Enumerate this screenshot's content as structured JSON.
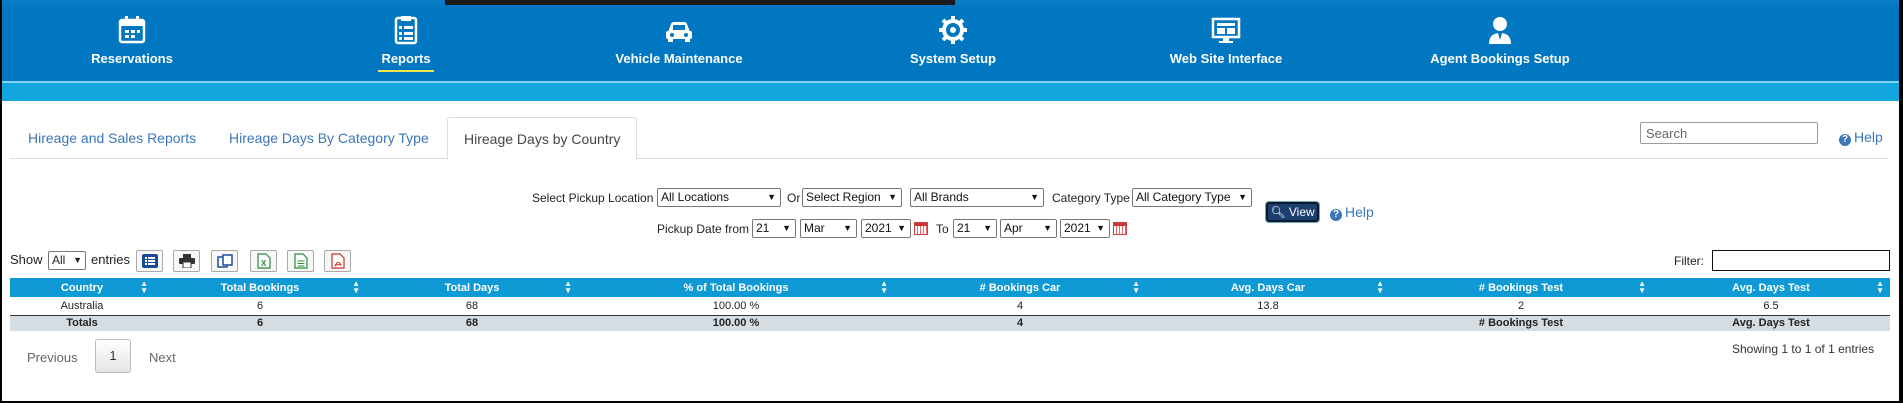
{
  "nav": {
    "items": [
      {
        "label": "Reservations",
        "icon": "calendar-icon"
      },
      {
        "label": "Reports",
        "icon": "clipboard-list-icon",
        "active": true
      },
      {
        "label": "Vehicle Maintenance",
        "icon": "car-icon"
      },
      {
        "label": "System Setup",
        "icon": "gear-icon"
      },
      {
        "label": "Web Site Interface",
        "icon": "monitor-icon"
      },
      {
        "label": "Agent Bookings Setup",
        "icon": "agent-icon"
      }
    ]
  },
  "tabs": [
    {
      "label": "Hireage and Sales Reports"
    },
    {
      "label": "Hireage Days By Category Type"
    },
    {
      "label": "Hireage Days by Country",
      "active": true
    }
  ],
  "search": {
    "placeholder": "Search"
  },
  "help_label": "Help",
  "filters": {
    "pickup_location_label": "Select Pickup Location",
    "pickup_location_value": "All Locations",
    "or_label": "Or",
    "region_value": "Select Region",
    "brands_value": "All Brands",
    "category_type_label": "Category Type",
    "category_type_value": "All Category Type",
    "pickup_date_from_label": "Pickup Date from",
    "from_day": "21",
    "from_month": "Mar",
    "from_year": "2021",
    "to_label": "To",
    "to_day": "21",
    "to_month": "Apr",
    "to_year": "2021",
    "view_label": "View",
    "help_label": "Help"
  },
  "toolbar": {
    "show_label": "Show",
    "entries_value": "All",
    "entries_label": "entries",
    "filter_label": "Filter:"
  },
  "table": {
    "columns": [
      "Country",
      "Total Bookings",
      "Total Days",
      "% of Total Bookings",
      "# Bookings Car",
      "Avg. Days Car",
      "# Bookings Test",
      "Avg. Days Test"
    ],
    "rows": [
      [
        "Australia",
        "6",
        "68",
        "100.00 %",
        "4",
        "13.8",
        "2",
        "6.5"
      ]
    ],
    "totals": [
      "Totals",
      "6",
      "68",
      "100.00 %",
      "4",
      "",
      "# Bookings Test",
      "Avg. Days Test"
    ]
  },
  "pagination": {
    "previous": "Previous",
    "page": "1",
    "next": "Next",
    "info": "Showing 1 to 1 of 1 entries"
  },
  "colors": {
    "nav_bg": "#0077c0",
    "subbar": "#12a6df",
    "table_header": "#0f9ad6",
    "link": "#3b76b8",
    "active_underline": "#f1e34b"
  }
}
